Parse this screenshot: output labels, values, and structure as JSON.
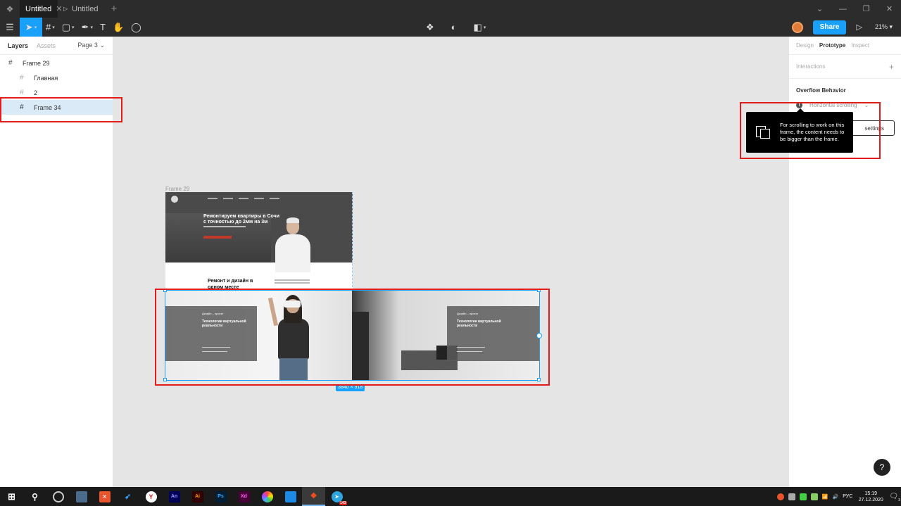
{
  "titlebar": {
    "tabs": [
      {
        "label": "Untitled",
        "active": true
      },
      {
        "label": "Untitled",
        "active": false
      }
    ],
    "new_tab": "+"
  },
  "toolbar": {
    "share_label": "Share",
    "zoom": "21%"
  },
  "left_panel": {
    "tabs": {
      "layers": "Layers",
      "assets": "Assets",
      "page": "Page 3"
    },
    "layers": [
      {
        "name": "Frame 29",
        "level": 0,
        "selected": false
      },
      {
        "name": "Главная",
        "level": 1,
        "selected": false
      },
      {
        "name": "2",
        "level": 1,
        "selected": false
      },
      {
        "name": "Frame 34",
        "level": 1,
        "selected": true
      }
    ]
  },
  "right_panel": {
    "tabs": {
      "design": "Design",
      "prototype": "Prototype",
      "inspect": "Inspect"
    },
    "interactions": "Interactions",
    "overflow_title": "Overflow Behavior",
    "overflow_value": "Horizontal scrolling",
    "settings_btn": "settings",
    "help": "?"
  },
  "tooltip": {
    "text": "For scrolling to work on this frame, the content needs to be bigger than the frame."
  },
  "canvas": {
    "frame29_label": "Frame 29",
    "hero_title": "Ремонтируем квартиры в Сочи с точностью до 2мм на 3м",
    "section2_title": "Ремонт и дизайн в одном месте",
    "vr_tag": "Дизайн – проект",
    "vr_title": "Технологии виртуальной реальности",
    "size_badge": "3840 × 918"
  },
  "taskbar": {
    "lang": "РУС",
    "time": "15:19",
    "date": "27.12.2020",
    "notif_count": "3",
    "telegram_badge": "143"
  },
  "colors": {
    "accent": "#18a0fb",
    "highlight": "#e21b1b",
    "ui_dark": "#2c2c2c"
  }
}
